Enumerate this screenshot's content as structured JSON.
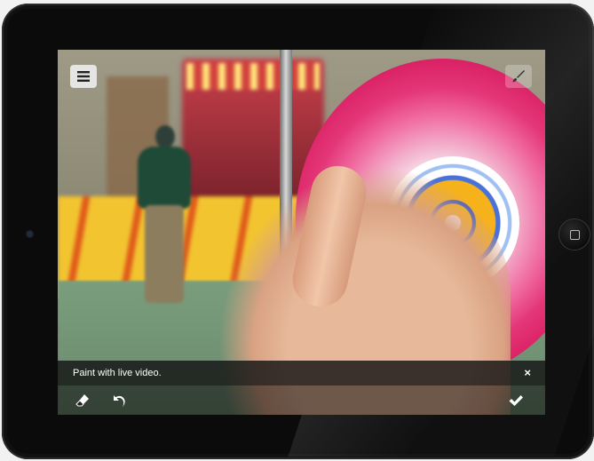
{
  "screen": {
    "toast": {
      "message": "Paint with live video.",
      "close_glyph": "×"
    }
  },
  "icons": {
    "menu": "hamburger-menu-icon",
    "brush": "paintbrush-icon",
    "eraser": "eraser-icon",
    "undo": "undo-arrow-icon",
    "confirm": "checkmark-icon"
  },
  "colors": {
    "bezel": "#0b0b0b",
    "toast_bg": "#141414",
    "toolbar_icon": "#ffffff"
  }
}
